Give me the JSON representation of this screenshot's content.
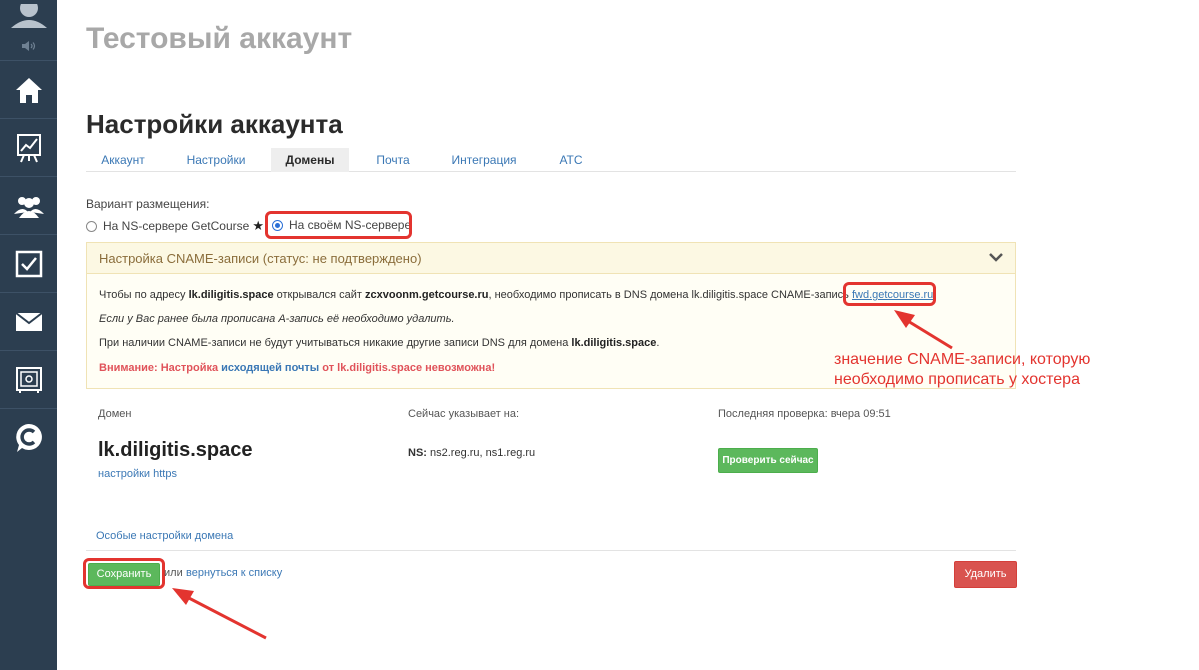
{
  "account_title": "Тестовый аккаунт",
  "page_title": "Настройки аккаунта",
  "tabs": [
    {
      "label": "Аккаунт",
      "active": false
    },
    {
      "label": "Настройки",
      "active": false
    },
    {
      "label": "Домены",
      "active": true
    },
    {
      "label": "Почта",
      "active": false
    },
    {
      "label": "Интеграция",
      "active": false
    },
    {
      "label": "АТС",
      "active": false
    }
  ],
  "placement": {
    "label": "Вариант размещения:",
    "option_getcourse": "На NS-сервере GetCourse",
    "option_own": "На своём NS-сервере",
    "selected": "option_own"
  },
  "cname_panel": {
    "title": "Настройка CNAME-записи (статус: не подтверждено)",
    "line1_a": "Чтобы по адресу ",
    "line1_domain": "lk.diligitis.space",
    "line1_b": " открывался сайт ",
    "line1_site": "zcxvoonm.getcourse.ru",
    "line1_c": ", необходимо прописать в DNS домена lk.diligitis.space CNAME-запись ",
    "cname_value": "fwd.getcourse.ru",
    "line2": "Если у Вас ранее была прописана А-запись её необходимо удалить.",
    "line3_a": "При наличии CNAME-записи не будут учитываться никакие другие записи DNS для домена ",
    "line3_domain": "lk.diligitis.space",
    "line3_b": ".",
    "warn_a": "Внимание: Настройка ",
    "warn_link": "исходящей почты",
    "warn_b": " от lk.diligitis.space невозможна!"
  },
  "annotation": {
    "line1": "значение CNAME-записи, которую",
    "line2": "необходимо прописать у хостера"
  },
  "domain_table": {
    "col_domain": "Домен",
    "col_points": "Сейчас указывает на:",
    "col_check": "Последняя проверка: вчера 09:51",
    "domain": "lk.diligitis.space",
    "https_link": "настройки https",
    "ns_label": "NS:",
    "ns_value": " ns2.reg.ru, ns1.reg.ru",
    "check_button": "Проверить сейчас"
  },
  "special_link": "Особые настройки домена",
  "footer": {
    "save": "Сохранить",
    "or": "или",
    "back": "вернуться к списку",
    "delete": "Удалить"
  },
  "colors": {
    "sidebar": "#2c3e50",
    "highlight": "#e3342f",
    "success": "#5cb85c",
    "danger": "#d9534f",
    "link": "#3b78b5"
  }
}
